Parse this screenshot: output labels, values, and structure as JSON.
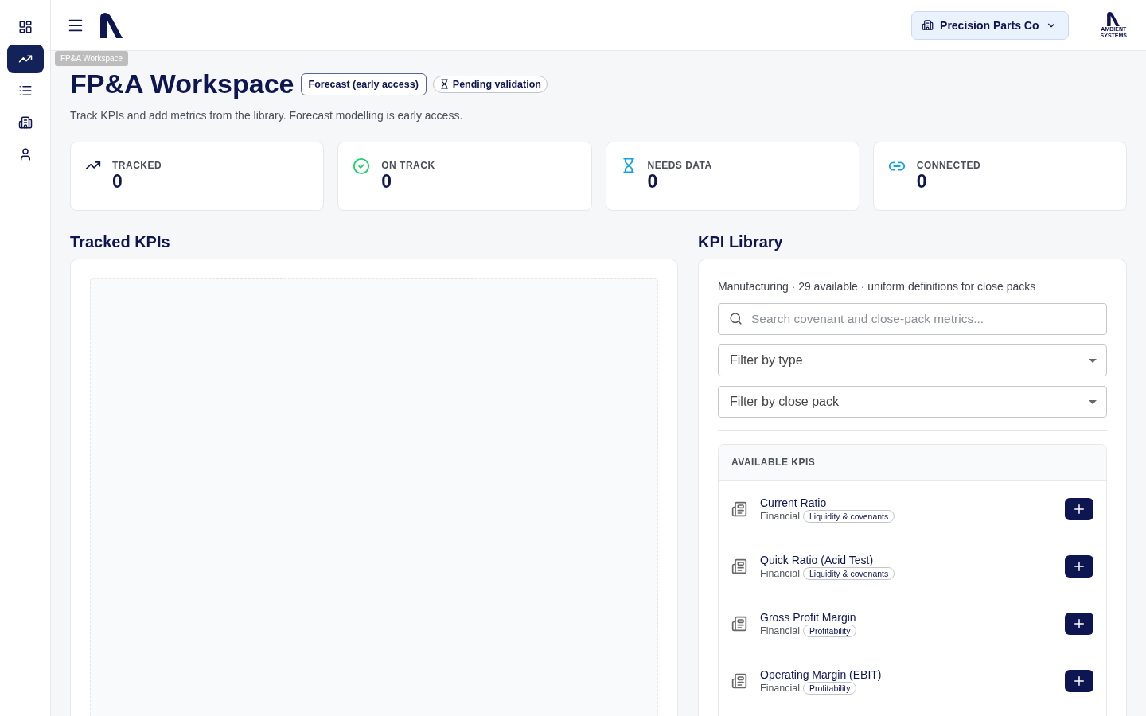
{
  "sidebar": {
    "items": [
      {
        "kind": "dashboard",
        "selected": false
      },
      {
        "kind": "trend",
        "selected": true
      },
      {
        "kind": "list",
        "selected": false
      },
      {
        "kind": "building",
        "selected": false
      },
      {
        "kind": "person",
        "selected": false
      }
    ],
    "tooltip": "FP&A Workspace"
  },
  "topbar": {
    "company": "Precision Parts Co",
    "logo_text": [
      "AMBIENT",
      "SYSTEMS"
    ]
  },
  "header": {
    "title": "FP&A Workspace",
    "badges": [
      {
        "kind": "outline",
        "label": "Forecast (early access)"
      },
      {
        "kind": "pending",
        "label": "Pending validation"
      }
    ],
    "subtitle": "Track KPIs and add metrics from the library. Forecast modelling is early access."
  },
  "stats": [
    {
      "kind": "tracked",
      "label": "TRACKED",
      "value": "0"
    },
    {
      "kind": "on_track",
      "label": "ON TRACK",
      "value": "0"
    },
    {
      "kind": "needs_data",
      "label": "NEEDS DATA",
      "value": "0"
    },
    {
      "kind": "connected",
      "label": "CONNECTED",
      "value": "0"
    }
  ],
  "tracked": {
    "title": "Tracked KPIs"
  },
  "library": {
    "title": "KPI Library",
    "summary": "Manufacturing · 29 available · uniform definitions for close packs",
    "search": {
      "placeholder": "Search covenant and close-pack metrics..."
    },
    "filters": [
      "Filter by type",
      "Filter by close pack"
    ],
    "list_title": "AVAILABLE KPIS",
    "items": [
      {
        "name": "Current Ratio",
        "type": "Financial",
        "tag": "Liquidity & covenants"
      },
      {
        "name": "Quick Ratio (Acid Test)",
        "type": "Financial",
        "tag": "Liquidity & covenants"
      },
      {
        "name": "Gross Profit Margin",
        "type": "Financial",
        "tag": "Profitability"
      },
      {
        "name": "Operating Margin (EBIT)",
        "type": "Financial",
        "tag": "Profitability"
      }
    ]
  }
}
